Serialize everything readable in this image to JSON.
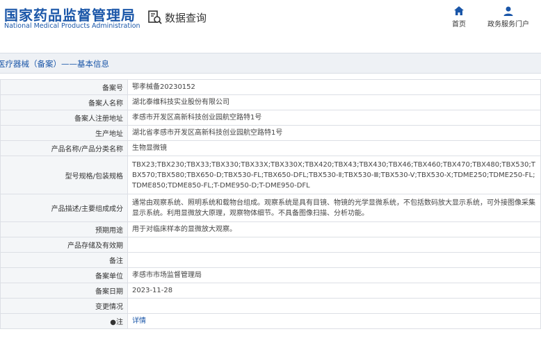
{
  "header": {
    "title_cn": "国家药品监督管理局",
    "title_en": "National Medical Products Administration",
    "query_label": "数据查询",
    "nav": [
      {
        "icon": "home-icon",
        "label": "首页"
      },
      {
        "icon": "user-icon",
        "label": "政务服务门户"
      }
    ]
  },
  "page_title": "医疗器械（备案）——基本信息",
  "rows": [
    {
      "label": "备案号",
      "value": "鄂孝械备20230152"
    },
    {
      "label": "备案人名称",
      "value": "湖北泰维科技实业股份有限公司"
    },
    {
      "label": "备案人注册地址",
      "value": "孝感市开发区高新科技创业园航空路特1号"
    },
    {
      "label": "生产地址",
      "value": "湖北省孝感市开发区高新科技创业园航空路特1号"
    },
    {
      "label": "产品名称/产品分类名称",
      "value": "生物显微镜"
    },
    {
      "label": "型号规格/包装规格",
      "value": "TBX23;TBX230;TBX33;TBX330;TBX33X;TBX330X;TBX420;TBX43;TBX430;TBX46;TBX460;TBX470;TBX480;TBX530;TBX570;TBX580;TBX650-D;TBX530-FL;TBX650-DFL;TBX530-Ⅱ;TBX530-Ⅲ;TBX530-V;TBX530-X;TDME250;TDME250-FL;TDME850;TDME850-FL;T-DME950-D;T-DME950-DFL"
    },
    {
      "label": "产品描述/主要组成成分",
      "value": "通常由观察系统、照明系统和载物台组成。观察系统是具有目镜、物镜的光学显微系统，不包括数码放大显示系统，可外接图像采集显示系统。利用显微放大原理，观察物体细节。不具备图像扫描、分析功能。"
    },
    {
      "label": "预期用途",
      "value": "用于对临床样本的显微放大观察。"
    },
    {
      "label": "产品存储及有效期",
      "value": ""
    },
    {
      "label": "备注",
      "value": ""
    },
    {
      "label": "备案单位",
      "value": "孝感市市场监督管理局"
    },
    {
      "label": "备案日期",
      "value": "2023-11-28"
    },
    {
      "label": "变更情况",
      "value": ""
    },
    {
      "label": "●注",
      "value": "详情"
    }
  ],
  "colors": {
    "brand": "#1a56a8",
    "label_bg": "#f4f6f8",
    "title_bg": "#eef1f5"
  }
}
